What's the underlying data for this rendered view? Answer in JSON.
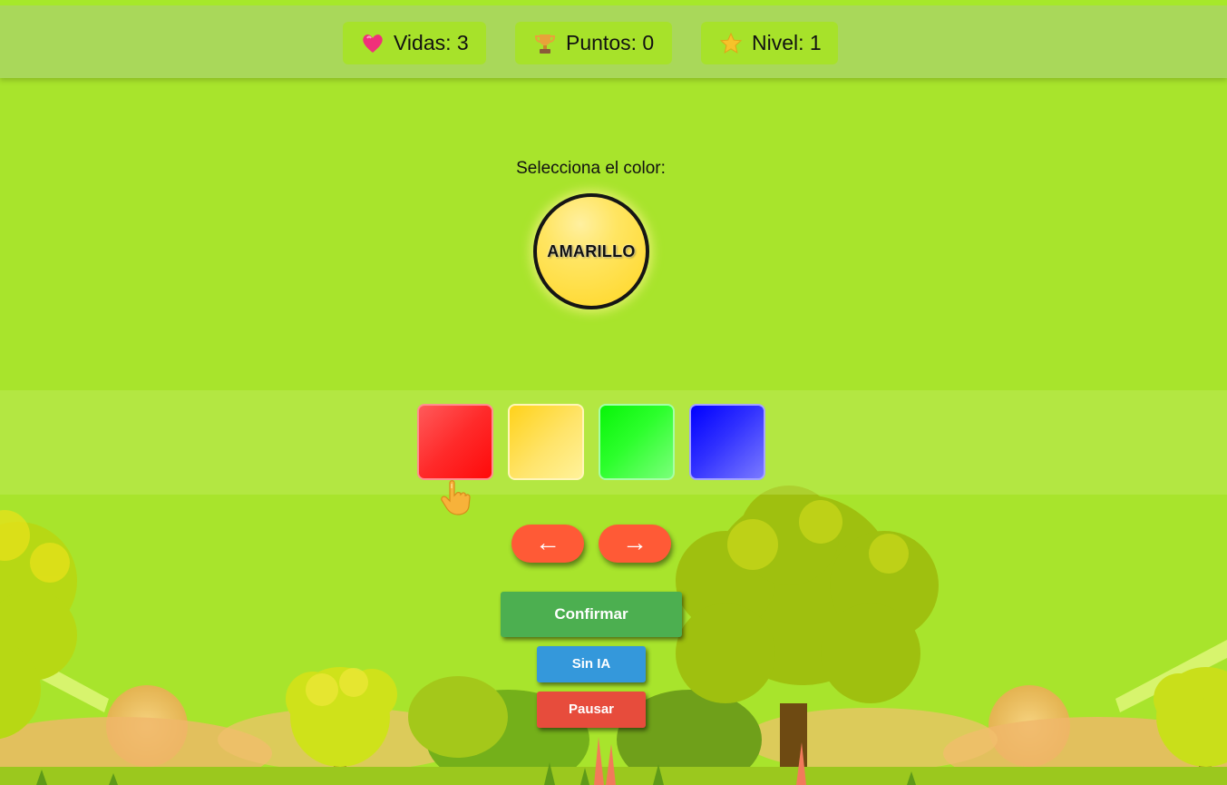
{
  "hud": {
    "lives_label": "Vidas: 3",
    "points_label": "Puntos: 0",
    "level_label": "Nivel: 1",
    "lives_icon": "heart-icon",
    "points_icon": "trophy-icon",
    "level_icon": "star-icon"
  },
  "challenge": {
    "prompt": "Selecciona el color:",
    "target_word": "AMARILLO",
    "target_color": "#ffe14d"
  },
  "options": [
    {
      "color": "#ff1a1a",
      "name": "red"
    },
    {
      "color": "#ffe14d",
      "name": "yellow"
    },
    {
      "color": "#1aff1a",
      "name": "green"
    },
    {
      "color": "#1a1aff",
      "name": "blue"
    }
  ],
  "navigation": {
    "left_arrow": "←",
    "right_arrow": "→"
  },
  "actions": {
    "confirm_label": "Confirmar",
    "no_ai_label": "Sin IA",
    "pause_label": "Pausar"
  },
  "colors": {
    "background": "#a8e42c",
    "confirm": "#4caf50",
    "no_ai": "#3498db",
    "pause": "#e74c3c",
    "arrows": "#ff5a36"
  }
}
